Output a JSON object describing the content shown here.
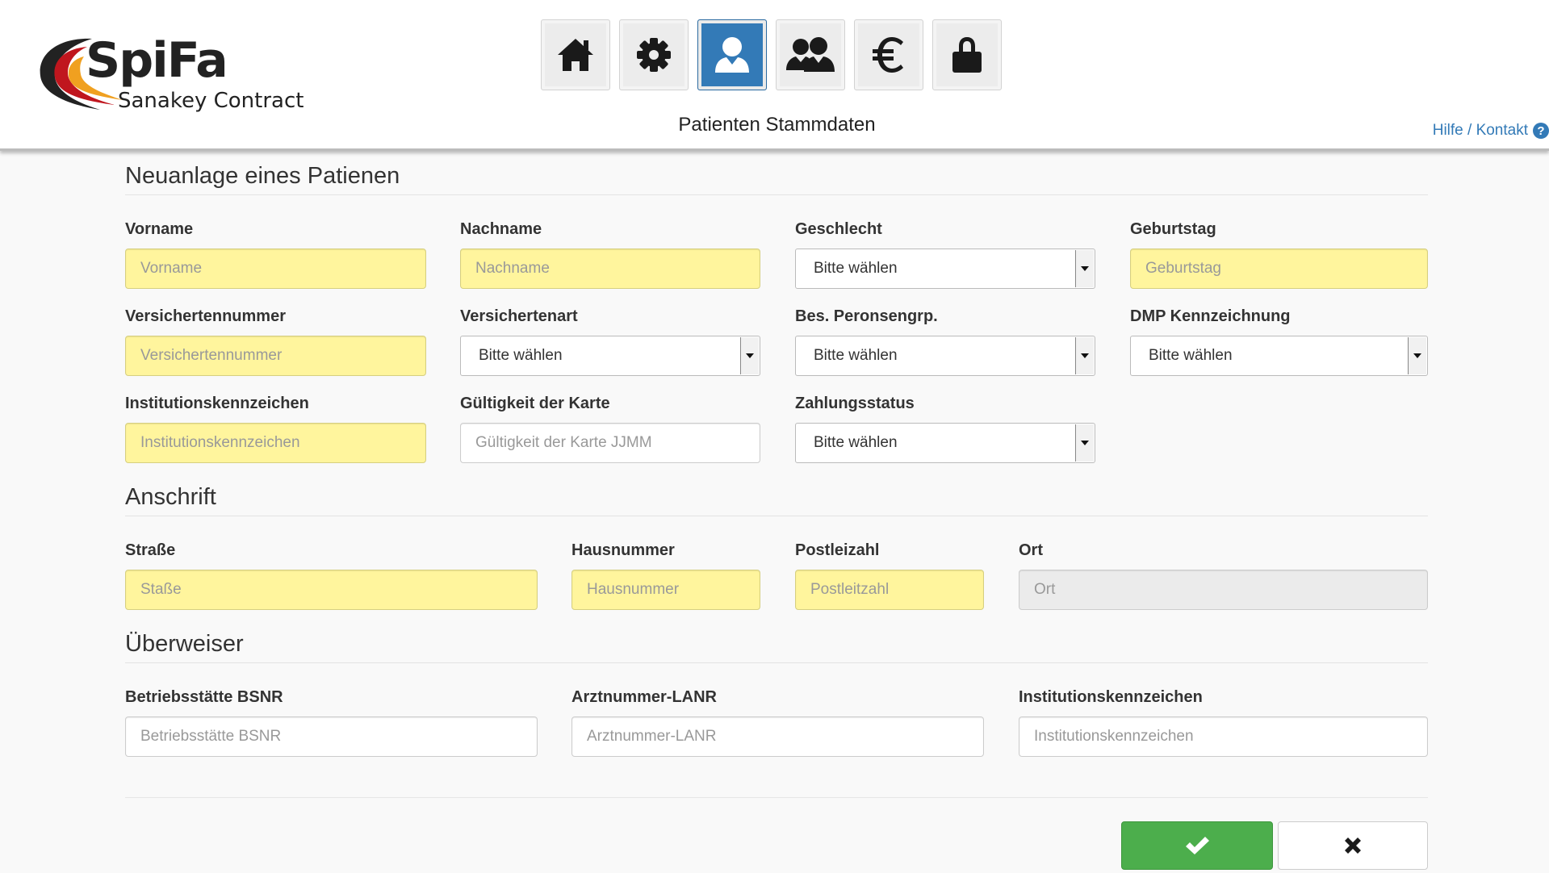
{
  "app": {
    "logo_main": "SpiFa",
    "logo_sub": "Sanakey Contract",
    "page_subtitle": "Patienten Stammdaten",
    "help_link": "Hilfe / Kontakt",
    "help_icon_glyph": "?"
  },
  "nav": [
    {
      "name": "home-icon",
      "active": false
    },
    {
      "name": "gear-icon",
      "active": false
    },
    {
      "name": "user-icon",
      "active": true
    },
    {
      "name": "users-icon",
      "active": false
    },
    {
      "name": "euro-icon",
      "active": false
    },
    {
      "name": "lock-icon",
      "active": false
    }
  ],
  "sections": {
    "patient": "Neuanlage eines Patienen",
    "address": "Anschrift",
    "referrer": "Überweiser"
  },
  "fields": {
    "vorname": {
      "label": "Vorname",
      "placeholder": "Vorname"
    },
    "nachname": {
      "label": "Nachname",
      "placeholder": "Nachname"
    },
    "geschlecht": {
      "label": "Geschlecht",
      "value": "Bitte wählen"
    },
    "geburtstag": {
      "label": "Geburtstag",
      "placeholder": "Geburtstag"
    },
    "versichertennummer": {
      "label": "Versichertennummer",
      "placeholder": "Versichertennummer"
    },
    "versichertenart": {
      "label": "Versichertenart",
      "value": "Bitte wählen"
    },
    "bes_personengrp": {
      "label": "Bes. Peronsengrp.",
      "value": "Bitte wählen"
    },
    "dmp": {
      "label": "DMP Kennzeichnung",
      "value": "Bitte wählen"
    },
    "institutionskennzeichen": {
      "label": "Institutionskennzeichen",
      "placeholder": "Institutionskennzeichen"
    },
    "gueltigkeit": {
      "label": "Gültigkeit der Karte",
      "placeholder": "Gültigkeit der Karte JJMM"
    },
    "zahlungsstatus": {
      "label": "Zahlungsstatus",
      "value": "Bitte wählen"
    },
    "strasse": {
      "label": "Straße",
      "placeholder": "Staße"
    },
    "hausnummer": {
      "label": "Hausnummer",
      "placeholder": "Hausnummer"
    },
    "postleitzahl": {
      "label": "Postleizahl",
      "placeholder": "Postleitzahl"
    },
    "ort": {
      "label": "Ort",
      "placeholder": "Ort"
    },
    "bsnr": {
      "label": "Betriebsstätte BSNR",
      "placeholder": "Betriebsstätte BSNR"
    },
    "lanr": {
      "label": "Arztnummer-LANR",
      "placeholder": "Arztnummer-LANR"
    },
    "ik_ueberweiser": {
      "label": "Institutionskennzeichen",
      "placeholder": "Institutionskennzeichen"
    }
  },
  "actions": {
    "confirm_icon": "check-icon",
    "cancel_icon": "close-icon"
  },
  "colors": {
    "required_bg": "#fff59d",
    "primary": "#337ab7",
    "success": "#4cae4c"
  }
}
